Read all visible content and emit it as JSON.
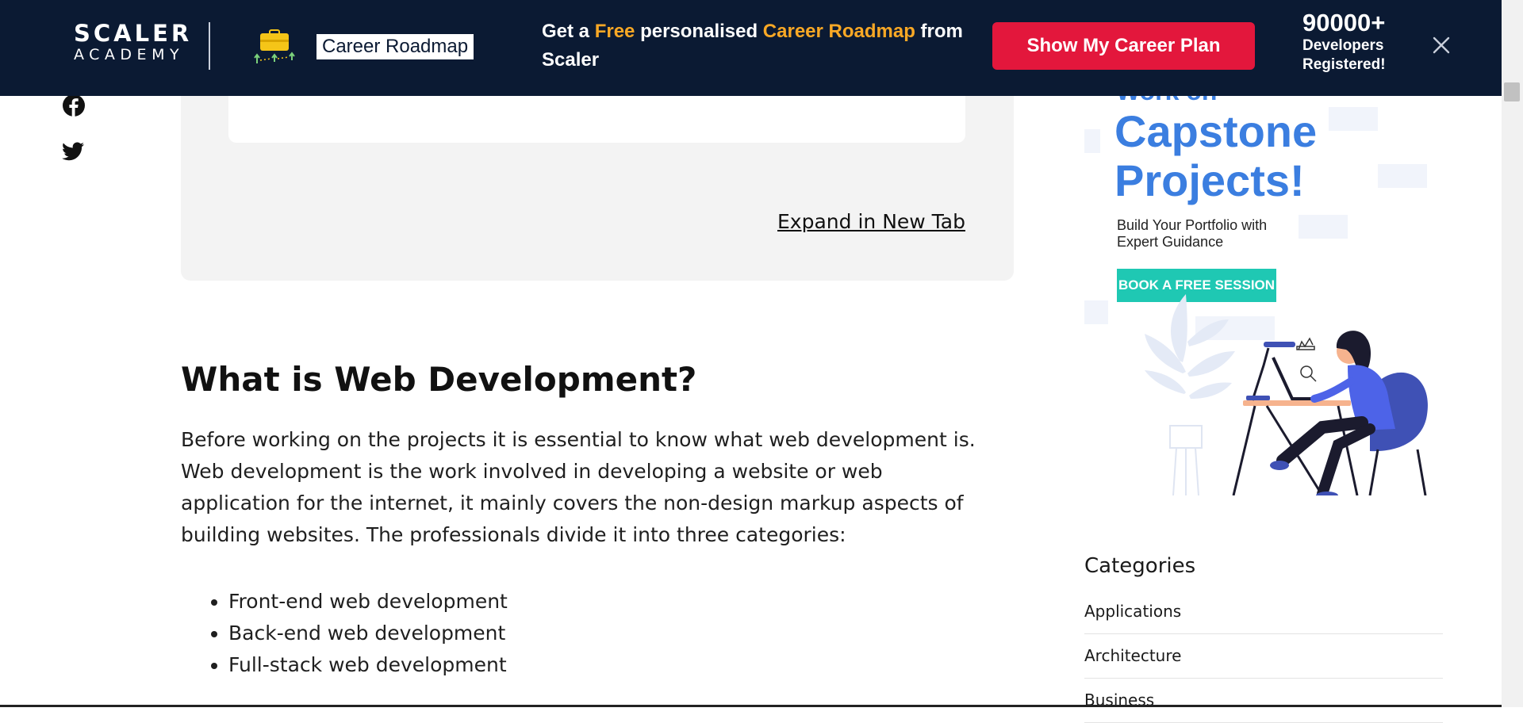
{
  "banner": {
    "brand_top": "SCALER",
    "brand_bottom": "ACADEMY",
    "roadmap_label": "Career Roadmap",
    "promo_1": "Get a ",
    "promo_free": "Free",
    "promo_2": " personalised ",
    "promo_roadmap": "Career Roadmap",
    "promo_3": " from Scaler",
    "cta_label": "Show My Career Plan",
    "dev_count": "90000+",
    "dev_caption_1": "Developers",
    "dev_caption_2": "Registered!",
    "close_icon": "close-icon",
    "background_color": "#0b1a33",
    "accent_color": "#f9a825",
    "cta_color": "#e3173c"
  },
  "social": {
    "icons": [
      "facebook-icon",
      "twitter-icon"
    ]
  },
  "embed": {
    "expand_label": "Expand in New Tab"
  },
  "article": {
    "heading": "What is Web Development?",
    "paragraph": "Before working on the projects it is essential to know what web development is. Web development is the work involved in developing a website or web application for the internet, it mainly covers the non-design markup aspects of building websites. The professionals divide it into three categories:",
    "list": [
      "Front-end web development",
      "Back-end web development",
      "Full-stack web development"
    ]
  },
  "ad": {
    "top_clip": "Work on",
    "headline_1": "Capstone",
    "headline_2": "Projects!",
    "subtext": "Build Your Portfolio with Expert Guidance",
    "button_label": "BOOK A FREE SESSION",
    "headline_color": "#3b7ee0",
    "button_color": "#1fc8b3"
  },
  "categories": {
    "title": "Categories",
    "items": [
      "Applications",
      "Architecture",
      "Business"
    ]
  }
}
